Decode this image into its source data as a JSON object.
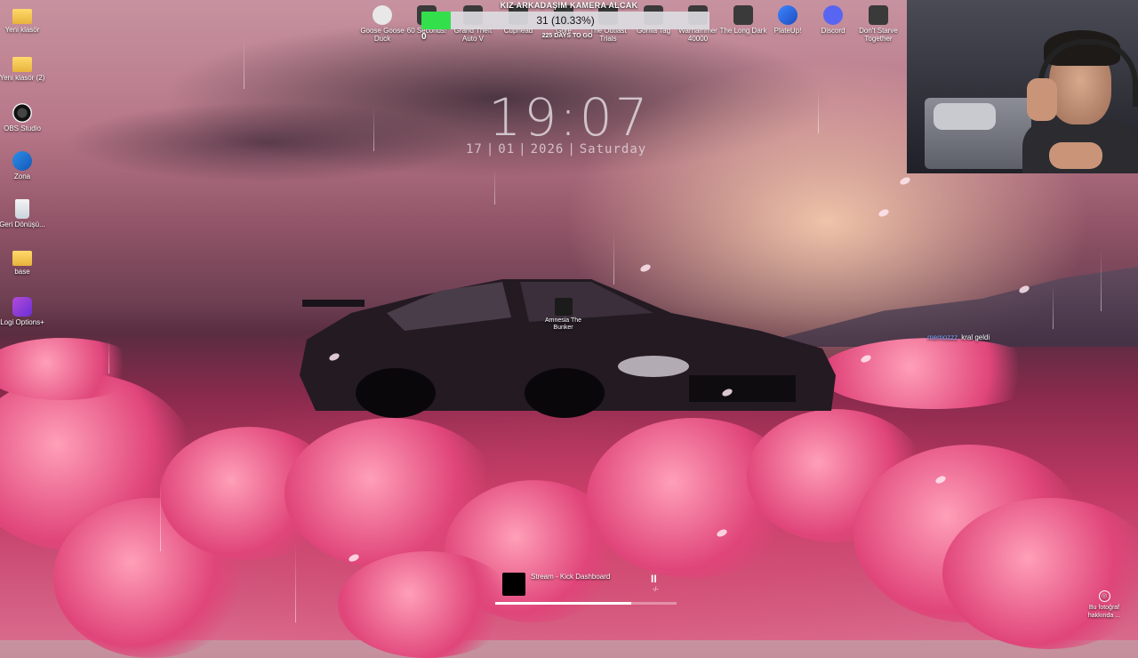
{
  "desktop_left": [
    {
      "label": "Yeni klasör",
      "icon": "folder-icon"
    },
    {
      "label": "Yeni klasör (2)",
      "icon": "folder-icon"
    },
    {
      "label": "OBS Studio",
      "icon": "obs-icon"
    },
    {
      "label": "Zona",
      "icon": "zona-icon"
    },
    {
      "label": "Geri Dönüşü...",
      "icon": "recycle-bin-icon"
    },
    {
      "label": "base",
      "icon": "folder-icon"
    },
    {
      "label": "Logi Options+",
      "icon": "logi-icon"
    }
  ],
  "desktop_top": [
    {
      "label": "Goose Goose Duck",
      "icon": "goose-icon"
    },
    {
      "label": "60 Seconds!",
      "icon": "game-icon"
    },
    {
      "label": "Grand Theft Auto V",
      "icon": "game-icon"
    },
    {
      "label": "Cuphead",
      "icon": "game-icon"
    },
    {
      "label": "Gore",
      "icon": "game-icon"
    },
    {
      "label": "The Outlast Trials",
      "icon": "game-icon"
    },
    {
      "label": "Gorilla Tag",
      "icon": "game-icon"
    },
    {
      "label": "Warhammer 40000",
      "icon": "game-icon"
    },
    {
      "label": "The Long Dark",
      "icon": "game-icon"
    },
    {
      "label": "PlateUp!",
      "icon": "plateup-icon"
    },
    {
      "label": "Discord",
      "icon": "discord-icon"
    },
    {
      "label": "Don't Starve Together",
      "icon": "game-icon"
    }
  ],
  "goal": {
    "title": "KIZ ARKADAŞIM KAMERA ALCAK",
    "text": "31 (10.33%)",
    "progress": 0.1033,
    "subtitle": "225 DAYS TO GO",
    "left_value": "0",
    "fill_color": "#33e04b"
  },
  "clock": {
    "time": "19:07",
    "day": "17",
    "month": "01",
    "year": "2026",
    "weekday": "Saturday"
  },
  "center_icon": {
    "label": "Amnesia The Bunker",
    "icon": "amnesia-icon"
  },
  "chat": {
    "user": "memozzz",
    "message": "kral geldi"
  },
  "media": {
    "title": "Stream - Kick Dashboard",
    "pause_glyph": "II",
    "time": "-/-",
    "progress": 0.75
  },
  "spotlight": {
    "label": "Bu fotoğraf hakkında ..."
  }
}
